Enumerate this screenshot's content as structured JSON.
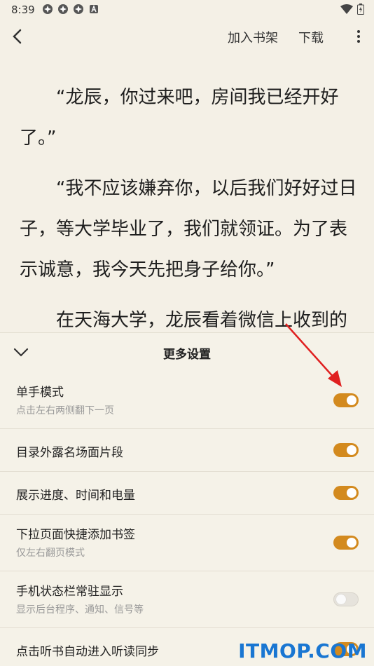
{
  "status": {
    "time": "8:39"
  },
  "topbar": {
    "add_shelf": "加入书架",
    "download": "下载"
  },
  "reader": {
    "paragraphs": [
      "“龙辰，你过来吧，房间我已经开好了。”",
      "“我不应该嫌弃你，以后我们好好过日子，等大学毕业了，我们就领证。为了表示诚意，我今天先把身子给你。”",
      "在天海大学，龙辰看着微信上收到的"
    ]
  },
  "panel": {
    "title": "更多设置",
    "rows": [
      {
        "label": "单手模式",
        "sub": "点击左右两侧翻下一页",
        "on": true
      },
      {
        "label": "目录外露名场面片段",
        "sub": "",
        "on": true
      },
      {
        "label": "展示进度、时间和电量",
        "sub": "",
        "on": true
      },
      {
        "label": "下拉页面快捷添加书签",
        "sub": "仅左右翻页模式",
        "on": true
      },
      {
        "label": "手机状态栏常驻显示",
        "sub": "显示后台程序、通知、信号等",
        "on": false
      },
      {
        "label": "点击听书自动进入听读同步",
        "sub": "",
        "on": true
      }
    ]
  },
  "watermark": "ITMOP.COM",
  "colors": {
    "accent": "#d38a1e",
    "background": "#f4f0e6",
    "arrow": "#e02020"
  }
}
